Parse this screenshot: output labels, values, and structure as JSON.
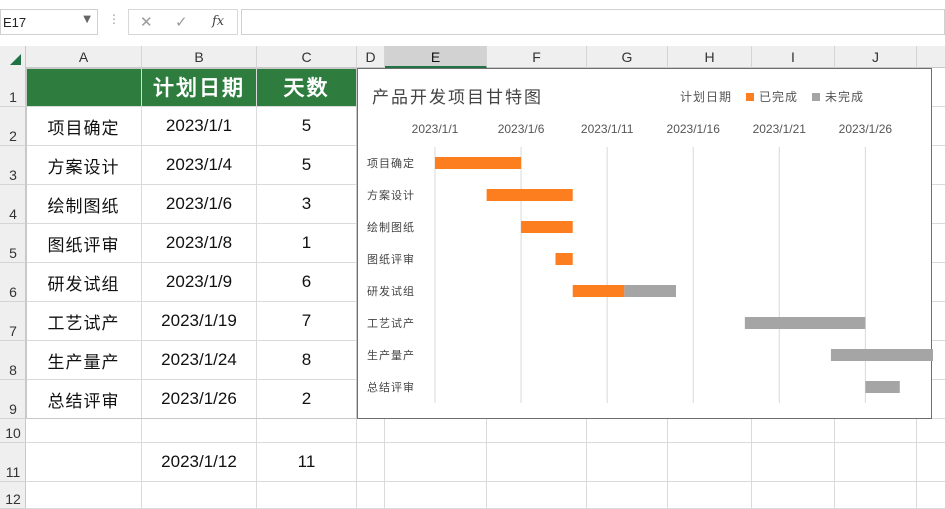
{
  "name_box": "E17",
  "formula_bar": {
    "dots": "⋮",
    "cancel_icon": "✕",
    "enter_icon": "✓",
    "fx_label": "fx",
    "formula_value": ""
  },
  "columns": [
    "A",
    "B",
    "C",
    "D",
    "E",
    "F",
    "G",
    "H",
    "I",
    "J"
  ],
  "rows": [
    "1",
    "2",
    "3",
    "4",
    "5",
    "6",
    "7",
    "8",
    "9",
    "10",
    "11",
    "12"
  ],
  "table": {
    "header": [
      "",
      "计划日期",
      "天数"
    ],
    "header_color": "#2e7d3f",
    "rows": [
      [
        "项目确定",
        "2023/1/1",
        "5"
      ],
      [
        "方案设计",
        "2023/1/4",
        "5"
      ],
      [
        "绘制图纸",
        "2023/1/6",
        "3"
      ],
      [
        "图纸评审",
        "2023/1/8",
        "1"
      ],
      [
        "研发试组",
        "2023/1/9",
        "6"
      ],
      [
        "工艺试产",
        "2023/1/19",
        "7"
      ],
      [
        "生产量产",
        "2023/1/24",
        "8"
      ],
      [
        "总结评审",
        "2023/1/26",
        "2"
      ]
    ],
    "row11": [
      "",
      "2023/1/12",
      "11"
    ]
  },
  "chart_data": {
    "type": "bar",
    "orientation": "horizontal",
    "stacked": true,
    "title": "产品开发项目甘特图",
    "x_tick_labels": [
      "2023/1/1",
      "2023/1/6",
      "2023/1/11",
      "2023/1/16",
      "2023/1/21",
      "2023/1/26"
    ],
    "xlim": [
      "2023/1/1",
      "2023/1/29"
    ],
    "major_unit_days": 5,
    "categories": [
      "项目确定",
      "方案设计",
      "绘制图纸",
      "图纸评审",
      "研发试组",
      "工艺试产",
      "生产量产",
      "总结评审"
    ],
    "start_dates": [
      "2023/1/1",
      "2023/1/4",
      "2023/1/6",
      "2023/1/8",
      "2023/1/9",
      "2023/1/19",
      "2023/1/24",
      "2023/1/26"
    ],
    "series": [
      {
        "name": "计划日期",
        "values": [
          0,
          0,
          0,
          0,
          0,
          0,
          0,
          0
        ],
        "color": "none"
      },
      {
        "name": "已完成",
        "values": [
          5,
          5,
          3,
          1,
          3,
          0,
          0,
          0
        ],
        "color": "#fd7e1f"
      },
      {
        "name": "未完成",
        "values": [
          0,
          0,
          0,
          0,
          3,
          7,
          8,
          2
        ],
        "color": "#a5a5a5"
      }
    ],
    "grid": "vertical",
    "legend": "top-right"
  }
}
